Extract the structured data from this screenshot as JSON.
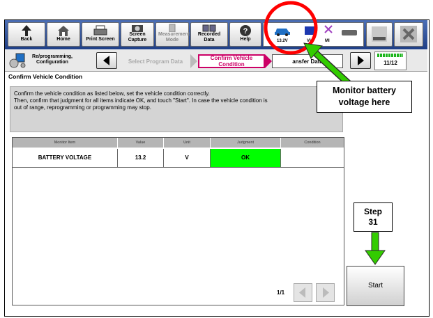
{
  "toolbar": {
    "back": "Back",
    "home": "Home",
    "print_screen": "Print Screen",
    "screen_capture": "Screen Capture",
    "measurement_mode": "Measurement Mode",
    "recorded_data": "Recorded Data",
    "help": "Help",
    "voltage": "13.2V",
    "vi": "VI",
    "mi": "MI"
  },
  "nav": {
    "breadcrumb": "Re/programming, Configuration",
    "step_prev": "Select Program Data",
    "step_current": "Confirm Vehicle Condition",
    "step_next": "Transfer Data",
    "step_next_visible": "ansfer Data",
    "page": "11/12"
  },
  "page": {
    "title": "Confirm Vehicle Condition",
    "instruction_line1": "Confirm the vehicle condition as listed below, set the vehicle condition correctly.",
    "instruction_line2": "Then, confirm that judgment for all items indicate OK, and touch \"Start\". In case the vehicle condition is",
    "instruction_line3": "out of range, reprogramming or programming may stop."
  },
  "table": {
    "headers": [
      "Monitor Item",
      "Value",
      "Unit",
      "Judgment",
      "Condition"
    ],
    "rows": [
      {
        "item": "BATTERY VOLTAGE",
        "value": "13.2",
        "unit": "V",
        "judgment": "OK",
        "condition": ""
      }
    ],
    "pagination": "1/1"
  },
  "annotations": {
    "callout_line1": "Monitor battery",
    "callout_line2": "voltage here",
    "step_line1": "Step",
    "step_line2": "31"
  },
  "start_label": "Start",
  "colors": {
    "toolbar": "#2d4f98",
    "ok_green": "#00ff00",
    "arrow_green": "#33cc00",
    "circle_red": "#ff0000",
    "current_step": "#cc0066"
  }
}
